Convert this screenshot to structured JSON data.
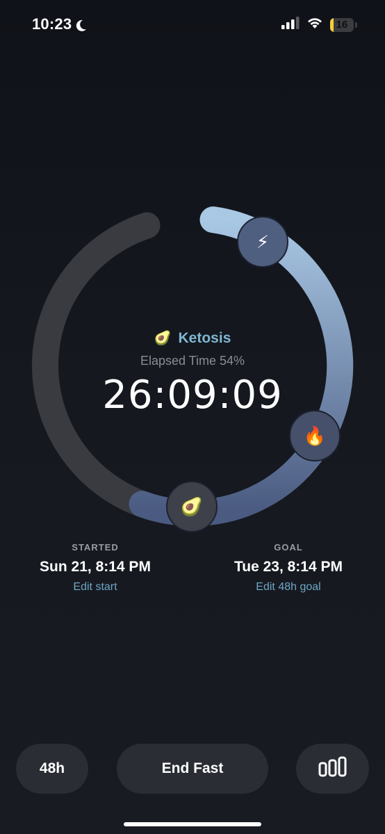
{
  "status_bar": {
    "time": "10:23",
    "battery_level": "16",
    "battery_fraction": 0.16,
    "icons": [
      "moon-icon",
      "signal-icon",
      "wifi-icon",
      "battery-icon"
    ]
  },
  "dial": {
    "progress_fraction": 0.54,
    "phase_emoji": "🥑",
    "phase_name": "Ketosis",
    "elapsed_label": "Elapsed Time 54%",
    "timer": "26:09:09",
    "markers": [
      {
        "name": "bolt",
        "emoji": "⚡"
      },
      {
        "name": "fire",
        "emoji": "🔥"
      },
      {
        "name": "avocado",
        "emoji": "🥑"
      }
    ],
    "colors": {
      "track": "#393b41",
      "progress_start": "#4a5a80",
      "progress_end": "#a9c8e4"
    }
  },
  "started": {
    "label": "STARTED",
    "value": "Sun 21, 8:14 PM",
    "edit": "Edit start"
  },
  "goal": {
    "label": "GOAL",
    "value": "Tue 23, 8:14 PM",
    "edit": "Edit 48h goal"
  },
  "buttons": {
    "duration": "48h",
    "end_fast": "End Fast",
    "stats_icon": "bar-chart-icon"
  },
  "accent_color": "#6fa7c6"
}
